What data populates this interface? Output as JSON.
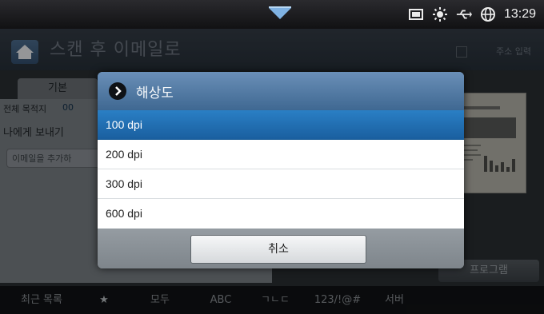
{
  "status": {
    "time": "13:29",
    "icons": [
      "pull-down-icon",
      "screen-icon",
      "brightness-icon",
      "usb-icon",
      "globe-icon"
    ]
  },
  "app": {
    "title": "스캔 후 이메일로",
    "address_input": "주소 입력",
    "tab_basic": "기본",
    "recipient_label": "전체 목적지",
    "recipient_count": "00",
    "send_to_me": "나에게 보내기",
    "add_email": "이메일을 추가하",
    "program_button": "프로그램"
  },
  "bottom_bar": {
    "items": [
      "최근 목록",
      "★",
      "모두",
      "ABC",
      "ㄱㄴㄷ",
      "123/!@#",
      "서버"
    ]
  },
  "dialog": {
    "title": "해상도",
    "options": [
      "100 dpi",
      "200 dpi",
      "300 dpi",
      "600 dpi"
    ],
    "selected": "100 dpi",
    "cancel_label": "취소"
  },
  "colors": {
    "dialog_header": "#4f79a5",
    "selected_option": "#2374ba"
  }
}
